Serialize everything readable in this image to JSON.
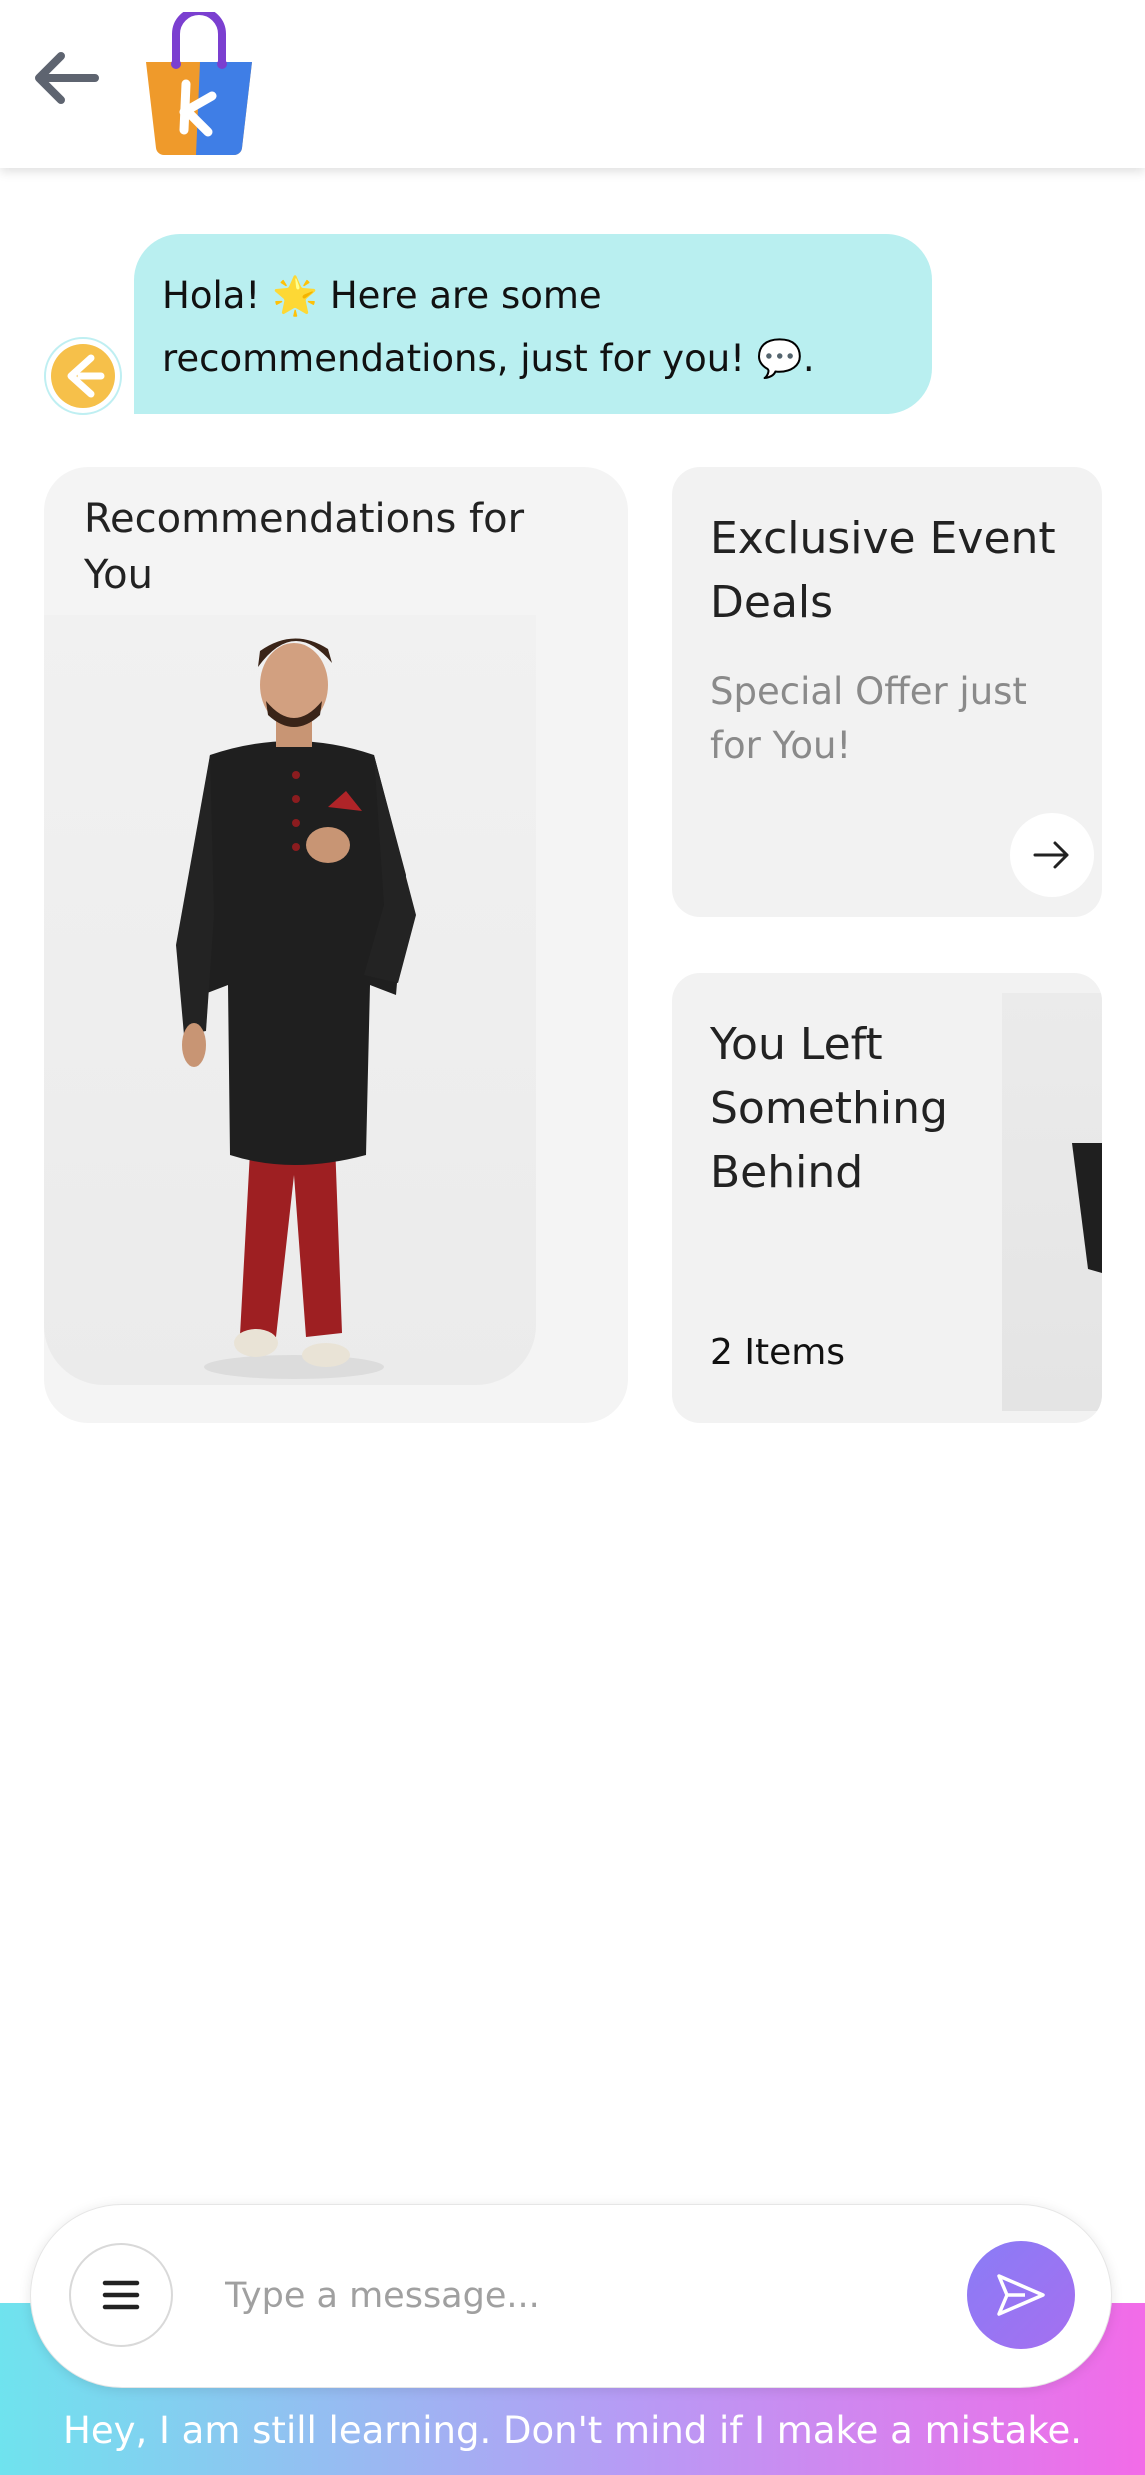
{
  "header": {
    "back_icon": "arrow-left-icon",
    "logo_icon": "shopping-bag-logo-icon"
  },
  "chat": {
    "bot_avatar_icon": "bot-avatar-icon",
    "greeting_line1": "Hola! 🌟 Here are some",
    "greeting_line2": "recommendations, just for you! 💬."
  },
  "cards": {
    "recommendations": {
      "title": "Recommendations for You"
    },
    "deals": {
      "title": "Exclusive Event Deals",
      "subtitle": "Special Offer just for You!",
      "arrow_icon": "arrow-right-icon"
    },
    "left_behind": {
      "title": "You Left Something Behind",
      "count": "2 Items"
    }
  },
  "composer": {
    "menu_icon": "menu-icon",
    "placeholder": "Type a message...",
    "send_icon": "send-icon"
  },
  "footer": {
    "note": "Hey, I am still learning. Don't mind if I make a mistake."
  },
  "colors": {
    "bubble": "#b9eff0",
    "send_button": "#8a7cf6",
    "footer_gradient_start": "#6fe3ee",
    "footer_gradient_end": "#f26be8"
  }
}
